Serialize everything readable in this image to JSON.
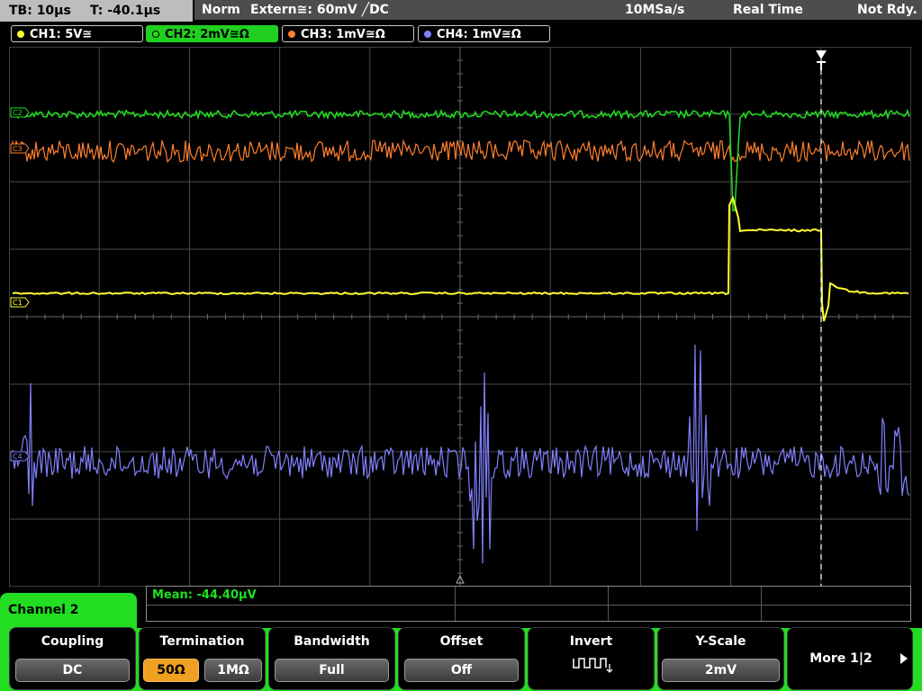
{
  "status": {
    "timebase": "TB: 10µs",
    "trigger_time": "T: -40.1µs",
    "mode": "Norm",
    "trigger": "Extern≅: 60mV ╱DC",
    "sample_rate": "10MSa/s",
    "acq_mode": "Real Time",
    "state": "Not Rdy."
  },
  "channels": [
    {
      "label": "CH1: 5V≅",
      "color": "#ffff30"
    },
    {
      "label": "CH2: 2mV≅Ω",
      "color": "#20e020"
    },
    {
      "label": "CH3: 1mV≅Ω",
      "color": "#ff8030"
    },
    {
      "label": "CH4: 1mV≅Ω",
      "color": "#8080ff"
    }
  ],
  "traces": {
    "ch2_marker": "C2",
    "ch3_marker": "C3",
    "ch1_marker": "C1",
    "ch4_marker": "C4"
  },
  "measurement": {
    "label": "Mean: -44.40µV"
  },
  "menu": {
    "title": "Channel 2",
    "softkeys": [
      {
        "title": "Coupling",
        "value": "DC"
      },
      {
        "title": "Termination",
        "options": [
          "50Ω",
          "1MΩ"
        ],
        "selected": "50Ω"
      },
      {
        "title": "Bandwidth",
        "value": "Full"
      },
      {
        "title": "Offset",
        "value": "Off"
      },
      {
        "title": "Invert",
        "icon": "invert-waveform-icon"
      },
      {
        "title": "Y-Scale",
        "value": "2mV"
      },
      {
        "title": "More 1|2",
        "icon": "right-arrow-icon"
      }
    ]
  },
  "colors": {
    "accent": "#22dd22",
    "grid": "#4a4a4a",
    "selected_option": "#f0a020"
  }
}
